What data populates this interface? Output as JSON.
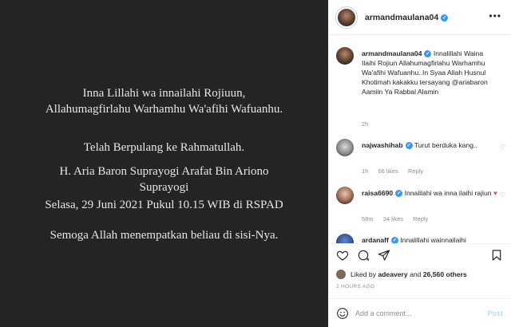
{
  "post_image": {
    "lines": [
      "Inna Lillahi wa innailahi Rojiuun,",
      "Allahumagfirlahu Warhamhu Wa'afihi Wafuanhu.",
      "Telah Berpulang ke Rahmatullah.",
      "H. Aria Baron Suprayogi Arafat Bin Ariono",
      "Suprayogi",
      "Selasa, 29 Juni 2021 Pukul 10.15 WIB di RSPAD",
      "Semoga Allah menempatkan beliau di sisi-Nya."
    ]
  },
  "header": {
    "username": "armandmaulana04",
    "verified": "✓"
  },
  "caption": {
    "username": "armandmaulana04",
    "text": "Innalillahi Waina Ilaihi Rojiun Allahumagfirlahu Warhamhu Wa'afihi Wafuanhu..In Syaa Allah Husnul Khotimah kakakku tersayang @ariabaron Aamiin Ya Rabbal Alamin",
    "time": "2h"
  },
  "comments": [
    {
      "username": "najwashihab",
      "text": "Turut berduka kang..",
      "time": "1h",
      "likes": "66 likes",
      "reply": "Reply"
    },
    {
      "username": "raisa6690",
      "text": "Innalilahi wa inna ilaihi rajiun",
      "time": "58m",
      "likes": "34 likes",
      "reply": "Reply"
    },
    {
      "username": "ardanaff",
      "text": "Innalillahi wainnailaihi"
    }
  ],
  "likes": {
    "prefix": "Liked by",
    "user": "adeavery",
    "middle": "and",
    "count": "26,560 others"
  },
  "timestamp": "2 HOURS AGO",
  "comment_box": {
    "placeholder": "Add a comment...",
    "post_label": "Post"
  },
  "colors": {
    "verified": "#3897f0",
    "heart_red": "#ed4956",
    "post_disabled": "#b2dffc"
  }
}
